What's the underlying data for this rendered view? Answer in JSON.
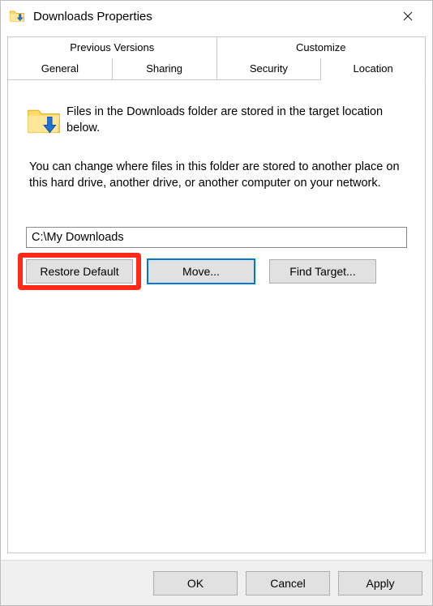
{
  "title": "Downloads Properties",
  "tabs": {
    "row1": [
      "Previous Versions",
      "Customize"
    ],
    "row2": [
      "General",
      "Sharing",
      "Security",
      "Location"
    ],
    "active": "Location"
  },
  "intro_text": "Files in the Downloads folder are stored in the target location below.",
  "description": "You can change where files in this folder are stored to another place on this hard drive, another drive, or another computer on your network.",
  "path_value": "C:\\My Downloads",
  "buttons": {
    "restore": "Restore Default",
    "move": "Move...",
    "find": "Find Target..."
  },
  "actions": {
    "ok": "OK",
    "cancel": "Cancel",
    "apply": "Apply"
  }
}
